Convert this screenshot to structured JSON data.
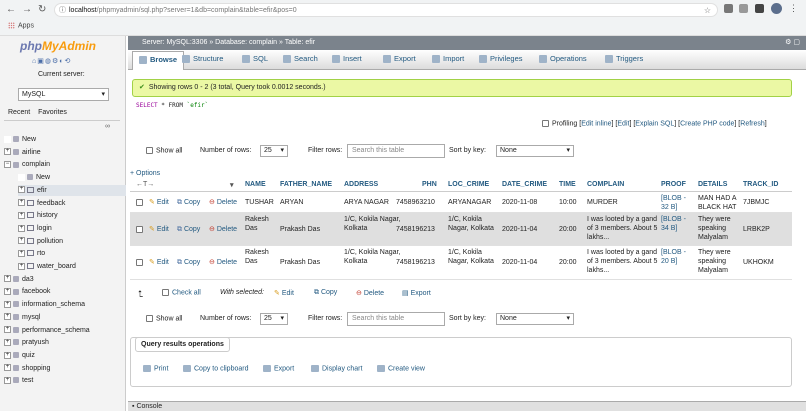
{
  "browser": {
    "url_host": "localhost",
    "url_rest": "/phpmyadmin/sql.php?server=1&db=complain&table=efir&pos=0",
    "apps_label": "Apps"
  },
  "sidebar": {
    "logo_php": "php",
    "logo_myadmin": "MyAdmin",
    "current_server_label": "Current server:",
    "server_value": "MySQL",
    "tab_recent": "Recent",
    "tab_favorites": "Favorites",
    "tree": [
      {
        "label": "New",
        "level": 0,
        "kind": "new"
      },
      {
        "label": "airline",
        "level": 0,
        "kind": "db"
      },
      {
        "label": "complain",
        "level": 0,
        "kind": "db"
      },
      {
        "label": "New",
        "level": 1,
        "kind": "new"
      },
      {
        "label": "efir",
        "level": 1,
        "kind": "tbl",
        "selected": true
      },
      {
        "label": "feedback",
        "level": 1,
        "kind": "tbl"
      },
      {
        "label": "history",
        "level": 1,
        "kind": "tbl"
      },
      {
        "label": "login",
        "level": 1,
        "kind": "tbl"
      },
      {
        "label": "pollution",
        "level": 1,
        "kind": "tbl"
      },
      {
        "label": "rto",
        "level": 1,
        "kind": "tbl"
      },
      {
        "label": "water_board",
        "level": 1,
        "kind": "tbl"
      },
      {
        "label": "da3",
        "level": 0,
        "kind": "db"
      },
      {
        "label": "facebook",
        "level": 0,
        "kind": "db"
      },
      {
        "label": "information_schema",
        "level": 0,
        "kind": "db"
      },
      {
        "label": "mysql",
        "level": 0,
        "kind": "db"
      },
      {
        "label": "performance_schema",
        "level": 0,
        "kind": "db"
      },
      {
        "label": "pratyush",
        "level": 0,
        "kind": "db"
      },
      {
        "label": "quiz",
        "level": 0,
        "kind": "db"
      },
      {
        "label": "shopping",
        "level": 0,
        "kind": "db"
      },
      {
        "label": "test",
        "level": 0,
        "kind": "db"
      }
    ]
  },
  "topbar": {
    "server": "Server: MySQL:3306",
    "database": "Database: complain",
    "table": "Table: efir"
  },
  "tabs": [
    "Browse",
    "Structure",
    "SQL",
    "Search",
    "Insert",
    "Export",
    "Import",
    "Privileges",
    "Operations",
    "Triggers"
  ],
  "status": {
    "message": "Showing rows 0 - 2 (3 total, Query took 0.0012 seconds.)",
    "sql_select": "SELECT",
    "sql_star_from": " * FROM ",
    "sql_table": "`efir`"
  },
  "profiling": {
    "label": "Profiling",
    "edit_inline": "Edit inline",
    "edit": "Edit",
    "explain": "Explain SQL",
    "create_php": "Create PHP code",
    "refresh": "Refresh"
  },
  "nav": {
    "show_all": "Show all",
    "num_rows_label": "Number of rows:",
    "num_rows_value": "25",
    "filter_label": "Filter rows:",
    "filter_placeholder": "Search this table",
    "sort_label": "Sort by key:",
    "sort_value": "None"
  },
  "options_label": "+ Options",
  "table": {
    "columns": [
      "NAME",
      "FATHER_NAME",
      "ADDRESS",
      "PHN",
      "LOC_CRIME",
      "DATE_CRIME",
      "TIME",
      "COMPLAIN",
      "PROOF",
      "DETAILS",
      "TRACK_ID"
    ],
    "action_edit": "Edit",
    "action_copy": "Copy",
    "action_delete": "Delete",
    "rows": [
      {
        "name": "TUSHAR",
        "father": "ARYAN",
        "address": "ARYA NAGAR",
        "phn": "7458963210",
        "loc": "ARYANAGAR",
        "date": "2020-11-08",
        "time": "10:00",
        "complain": "MURDER",
        "proof": "[BLOB - 32 B]",
        "details": "MAN HAD A BLACK HAT",
        "track": "7JBMJC"
      },
      {
        "name": "Rakesh Das",
        "father": "Prakash Das",
        "address": "1/C, Kokila Nagar, Kolkata",
        "phn": "7458196213",
        "loc": "1/C, Kokila Nagar, Kolkata",
        "date": "2020-11-04",
        "time": "20:00",
        "complain": "I was looted by a gand of 3 members. About 5 lakhs...",
        "proof": "[BLOB - 34 B]",
        "details": "They were speaking Malyalam",
        "track": "LRBK2P"
      },
      {
        "name": "Rakesh Das",
        "father": "Prakash Das",
        "address": "1/C, Kokila Nagar, Kolkata",
        "phn": "7458196213",
        "loc": "1/C, Kokila Nagar, Kolkata",
        "date": "2020-11-04",
        "time": "20:00",
        "complain": "I was looted by a gand of 3 members. About 5 lakhs...",
        "proof": "[BLOB - 20 B]",
        "details": "They were speaking Malyalam",
        "track": "UKHOKM"
      }
    ]
  },
  "with_selected": {
    "check_all": "Check all",
    "label": "With selected:",
    "edit": "Edit",
    "copy": "Copy",
    "delete": "Delete",
    "export": "Export"
  },
  "query_ops": {
    "title": "Query results operations",
    "print": "Print",
    "copy_clipboard": "Copy to clipboard",
    "export": "Export",
    "display_chart": "Display chart",
    "create_view": "Create view"
  },
  "console_label": "Console"
}
